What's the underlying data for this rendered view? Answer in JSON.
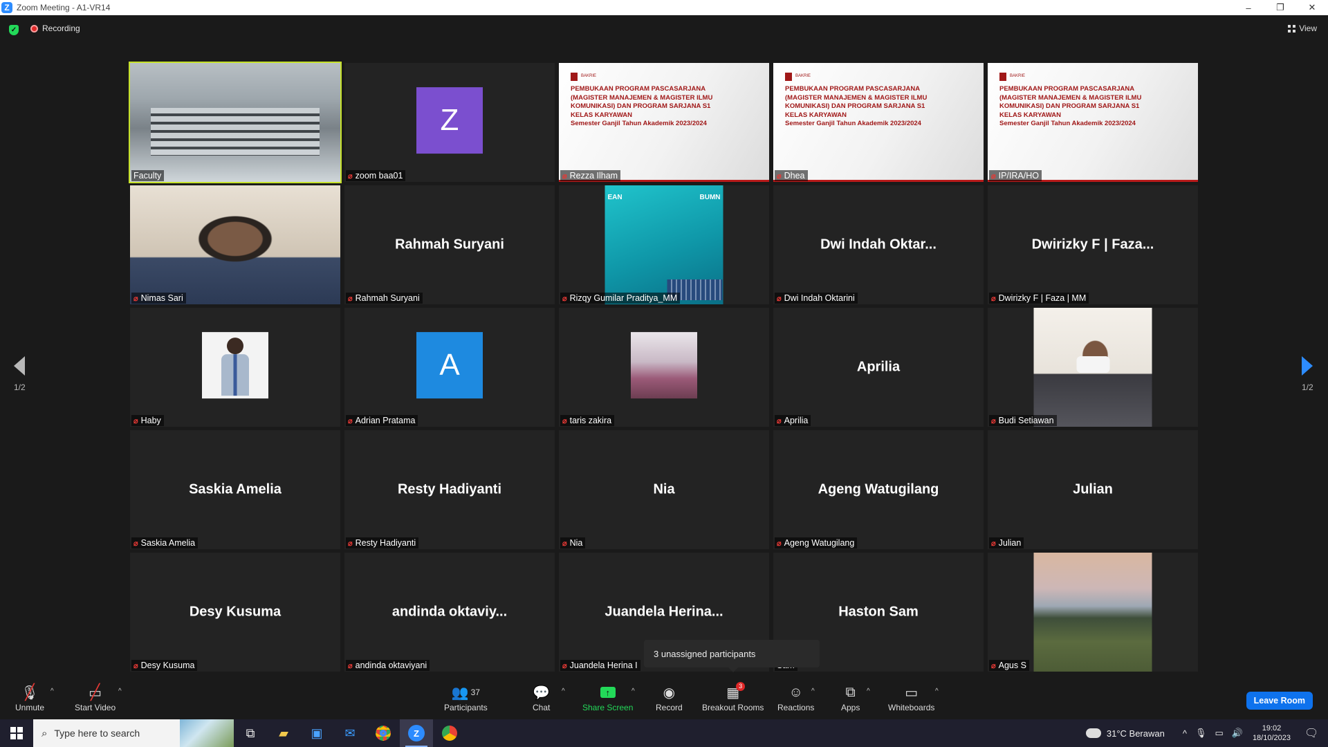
{
  "window": {
    "title": "Zoom Meeting - A1-VR14",
    "controls": [
      "–",
      "❐",
      "✕"
    ]
  },
  "topbar": {
    "recording_label": "Recording",
    "view_label": "View"
  },
  "gallery": {
    "tiles": [
      {
        "label": "Faculty",
        "big": "",
        "kind": "classroom",
        "active": true,
        "muted": false
      },
      {
        "label": "zoom baa01",
        "big": "",
        "kind": "avatar",
        "avatar_letter": "Z",
        "avatar_color": "#7b4fcf",
        "muted": true
      },
      {
        "label": "Rezza Ilham",
        "big": "",
        "kind": "slide",
        "muted": true
      },
      {
        "label": "Dhea",
        "big": "",
        "kind": "slide",
        "muted": true
      },
      {
        "label": "IP/IRA/HO",
        "big": "",
        "kind": "slide",
        "muted": true
      },
      {
        "label": "Nimas Sari",
        "big": "",
        "kind": "person",
        "muted": true
      },
      {
        "label": "Rahmah Suryani",
        "big": "Rahmah Suryani",
        "kind": "name",
        "muted": true
      },
      {
        "label": "Rizqy Gumilar Praditya_MM",
        "big": "",
        "kind": "poster",
        "muted": true
      },
      {
        "label": "Dwi Indah Oktarini",
        "big": "Dwi Indah Oktar...",
        "kind": "name",
        "muted": true
      },
      {
        "label": "Dwirizky F | Faza | MM",
        "big": "Dwirizky F | Faza...",
        "kind": "name",
        "muted": true
      },
      {
        "label": "Haby",
        "big": "",
        "kind": "man",
        "muted": true
      },
      {
        "label": "Adrian Pratama",
        "big": "",
        "kind": "avatar",
        "avatar_letter": "A",
        "avatar_color": "#1e8ae0",
        "muted": true
      },
      {
        "label": "taris zakira",
        "big": "",
        "kind": "group",
        "muted": true
      },
      {
        "label": "Aprilia",
        "big": "Aprilia",
        "kind": "name",
        "muted": true
      },
      {
        "label": "Budi Setiawan",
        "big": "",
        "kind": "masked",
        "muted": true
      },
      {
        "label": "Saskia Amelia",
        "big": "Saskia Amelia",
        "kind": "name",
        "muted": true
      },
      {
        "label": "Resty Hadiyanti",
        "big": "Resty Hadiyanti",
        "kind": "name",
        "muted": true
      },
      {
        "label": "Nia",
        "big": "Nia",
        "kind": "name",
        "muted": true
      },
      {
        "label": "Ageng Watugilang",
        "big": "Ageng Watugilang",
        "kind": "name",
        "muted": true
      },
      {
        "label": "Julian",
        "big": "Julian",
        "kind": "name",
        "muted": true
      },
      {
        "label": "Desy Kusuma",
        "big": "Desy Kusuma",
        "kind": "name",
        "muted": true
      },
      {
        "label": "andinda oktaviyani",
        "big": "andinda  oktaviy...",
        "kind": "name",
        "muted": true
      },
      {
        "label": "Juandela Herina I",
        "big": "Juandela  Herina...",
        "kind": "name",
        "muted": true
      },
      {
        "label": "Sam",
        "big": "Haston Sam",
        "kind": "name",
        "muted": false
      },
      {
        "label": "Agus S",
        "big": "",
        "kind": "field",
        "muted": true
      }
    ],
    "slide_text": {
      "logo_text": "BAKRIE",
      "lines": [
        "PEMBUKAAN PROGRAM PASCASARJANA",
        "(MAGISTER MANAJEMEN & MAGISTER ILMU",
        "KOMUNIKASI) DAN PROGRAM SARJANA S1",
        "KELAS KARYAWAN",
        "Semester Ganjil Tahun Akademik 2023/2024"
      ]
    },
    "poster_text": {
      "left": "EAN",
      "right": "BUMN"
    }
  },
  "pagination": {
    "left": "1/2",
    "right": "1/2"
  },
  "tooltip": {
    "text": "3 unassigned participants"
  },
  "toolbar": {
    "unmute": "Unmute",
    "start_video": "Start Video",
    "participants": "Participants",
    "participants_count": "37",
    "chat": "Chat",
    "share_screen": "Share Screen",
    "record": "Record",
    "breakout_rooms": "Breakout Rooms",
    "breakout_badge": "3",
    "reactions": "Reactions",
    "apps": "Apps",
    "whiteboards": "Whiteboards",
    "leave": "Leave Room"
  },
  "taskbar": {
    "search_placeholder": "Type here to search",
    "weather": "31°C  Berawan",
    "time": "19:02",
    "date": "18/10/2023"
  },
  "colors": {
    "accent": "#2d8cff",
    "active_border": "#c6e22a",
    "muted_icon": "#e53935",
    "share_green": "#23d959",
    "leave_blue": "#0e72ed"
  }
}
